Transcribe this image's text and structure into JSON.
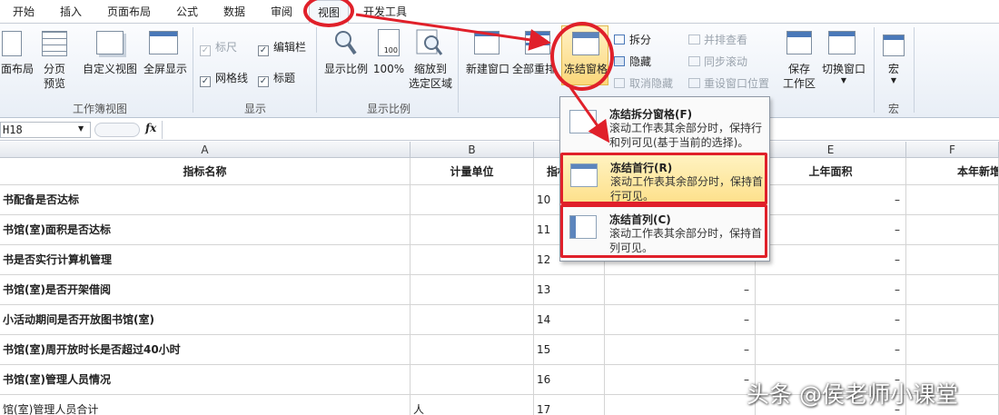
{
  "tabs": [
    "开始",
    "插入",
    "页面布局",
    "公式",
    "数据",
    "审阅",
    "视图",
    "开发工具"
  ],
  "active_tab": "视图",
  "ribbon": {
    "workbook_views": {
      "label": "工作簿视图",
      "page_layout": "面布局",
      "page_break_1": "分页",
      "page_break_2": "预览",
      "custom_view": "自定义视图",
      "full_screen": "全屏显示"
    },
    "show": {
      "label": "显示",
      "ruler": "标尺",
      "formula_bar": "编辑栏",
      "gridlines": "网格线",
      "headings": "标题"
    },
    "zoom": {
      "label": "显示比例",
      "zoom": "显示比例",
      "zoom100": "100%",
      "zoom_sel_1": "缩放到",
      "zoom_sel_2": "选定区域",
      "icon_text": "100"
    },
    "window": {
      "new_window": "新建窗口",
      "arrange_all": "全部重排",
      "freeze_panes": "冻结窗格",
      "split": "拆分",
      "hide": "隐藏",
      "unhide": "取消隐藏",
      "side_by_side": "并排查看",
      "sync_scroll": "同步滚动",
      "reset_pos": "重设窗口位置",
      "save_ws_1": "保存",
      "save_ws_2": "工作区",
      "switch_win": "切换窗口"
    },
    "macros": {
      "label": "宏",
      "button": "宏"
    }
  },
  "formula_bar": {
    "name_box": "H18",
    "fx": "fx"
  },
  "grid": {
    "columns": [
      "A",
      "B",
      "C",
      "D",
      "E",
      "F"
    ],
    "header_row": [
      "指标名称",
      "计量单位",
      "指标",
      "",
      "上年面积",
      "本年新增"
    ],
    "rows": [
      {
        "name": "书配备是否达标",
        "unit": "",
        "code": "10",
        "d": "",
        "e": "–",
        "f": ""
      },
      {
        "name": "书馆(室)面积是否达标",
        "unit": "",
        "code": "11",
        "d": "",
        "e": "–",
        "f": ""
      },
      {
        "name": "书是否实行计算机管理",
        "unit": "",
        "code": "12",
        "d": "–",
        "e": "–",
        "f": ""
      },
      {
        "name": "书馆(室)是否开架借阅",
        "unit": "",
        "code": "13",
        "d": "–",
        "e": "–",
        "f": ""
      },
      {
        "name": "小活动期间是否开放图书馆(室)",
        "unit": "",
        "code": "14",
        "d": "–",
        "e": "–",
        "f": ""
      },
      {
        "name": "书馆(室)周开放时长是否超过40小时",
        "unit": "",
        "code": "15",
        "d": "–",
        "e": "–",
        "f": ""
      },
      {
        "name": "书馆(室)管理人员情况",
        "unit": "",
        "code": "16",
        "d": "–",
        "e": "–",
        "f": ""
      },
      {
        "name": "馆(室)管理人员合计",
        "unit": "人",
        "code": "17",
        "d": "",
        "e": "–",
        "f": ""
      }
    ]
  },
  "freeze_menu": {
    "items": [
      {
        "title": "冻结拆分窗格(F)",
        "desc": "滚动工作表其余部分时，保持行和列可见(基于当前的选择)。"
      },
      {
        "title": "冻结首行(R)",
        "desc": "滚动工作表其余部分时，保持首行可见。"
      },
      {
        "title": "冻结首列(C)",
        "desc": "滚动工作表其余部分时，保持首列可见。"
      }
    ]
  },
  "watermark": "头条 @侯老师小课堂",
  "colors": {
    "highlight": "#e0202a",
    "menu_hover": "#fde08a"
  }
}
